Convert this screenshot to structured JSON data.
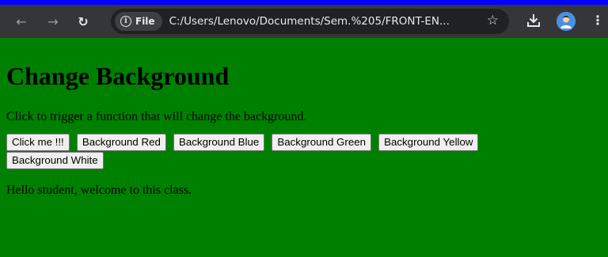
{
  "browser": {
    "site_chip_label": "File",
    "url": "C:/Users/Lenovo/Documents/Sem.%205/FRONT-EN...",
    "back_icon": "arrow-left-icon",
    "forward_icon": "arrow-right-icon",
    "reload_icon": "reload-icon"
  },
  "page": {
    "background_color": "#008000",
    "heading": "Change Background",
    "description": "Click to trigger a function that will change the background.",
    "buttons": [
      "Click me !!!",
      "Background Red",
      "Background Blue",
      "Background Green",
      "Background Yellow",
      "Background White"
    ],
    "message": "Hello student, welcome to this class."
  }
}
